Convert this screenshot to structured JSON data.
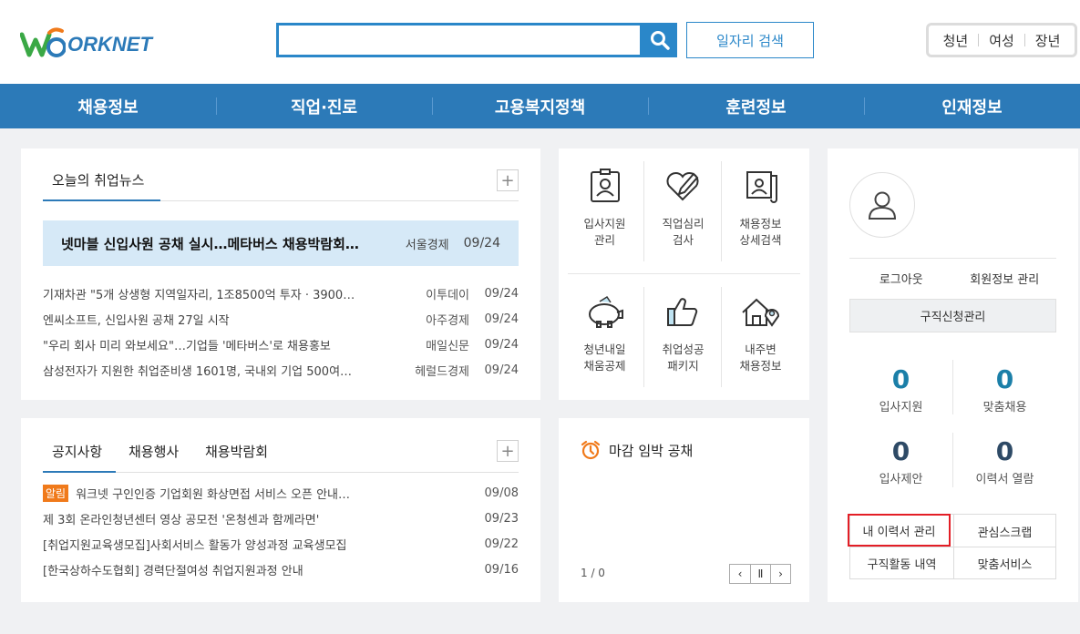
{
  "header": {
    "logo_text": "ORKNET",
    "search_placeholder": "",
    "search_value": "",
    "job_search_label": "일자리 검색",
    "user_types": [
      "청년",
      "여성",
      "장년"
    ]
  },
  "gnb": [
    "채용정보",
    "직업·진로",
    "고용복지정책",
    "훈련정보",
    "인재정보"
  ],
  "news": {
    "tab": "오늘의 취업뉴스",
    "plus": "+",
    "headline": {
      "title": "넷마블 신입사원 공채 실시…메타버스 채용박람회…",
      "source": "서울경제",
      "date": "09/24"
    },
    "items": [
      {
        "title": "기재차관 \"5개 상생형 지역일자리, 1조8500억 투자 · 3900…",
        "source": "이투데이",
        "date": "09/24"
      },
      {
        "title": "엔씨소프트, 신입사원 공채 27일 시작",
        "source": "아주경제",
        "date": "09/24"
      },
      {
        "title": "\"우리 회사 미리 와보세요\"…기업들 '메타버스'로 채용홍보",
        "source": "매일신문",
        "date": "09/24"
      },
      {
        "title": "삼성전자가 지원한 취업준비생 1601명, 국내외 기업 500여…",
        "source": "헤럴드경제",
        "date": "09/24"
      }
    ]
  },
  "notice": {
    "tabs": [
      "공지사항",
      "채용행사",
      "채용박람회"
    ],
    "plus": "+",
    "badge": "알림",
    "items": [
      {
        "title": "워크넷 구인인증 기업회원 화상면접 서비스 오픈 안내…",
        "date": "09/08"
      },
      {
        "title": "제 3회 온라인청년센터 영상 공모전 '온청센과 함께라면'",
        "date": "09/23"
      },
      {
        "title": "[취업지원교육생모집]사회서비스 활동가 양성과정 교육생모집",
        "date": "09/22"
      },
      {
        "title": "[한국상하수도협회] 경력단절여성 취업지원과정 안내",
        "date": "09/16"
      }
    ]
  },
  "menu": [
    {
      "line1": "입사지원",
      "line2": "관리",
      "icon": "id-card-icon"
    },
    {
      "line1": "직업심리",
      "line2": "검사",
      "icon": "heart-pen-icon"
    },
    {
      "line1": "채용정보",
      "line2": "상세검색",
      "icon": "scroll-icon"
    },
    {
      "line1": "청년내일",
      "line2": "채움공제",
      "icon": "piggy-bank-icon"
    },
    {
      "line1": "취업성공",
      "line2": "패키지",
      "icon": "thumbs-up-icon"
    },
    {
      "line1": "내주변",
      "line2": "채용정보",
      "icon": "house-pin-icon"
    }
  ],
  "deadline": {
    "title": "마감 임박 공채",
    "pager_text": "1 / 0",
    "prev": "‹",
    "pause": "Ⅱ",
    "next": "›"
  },
  "mypage": {
    "logout": "로그아웃",
    "member_info": "회원정보 관리",
    "manage": "구직신청관리",
    "stats": [
      {
        "value": "0",
        "label": "입사지원",
        "color": "#1b7fa8"
      },
      {
        "value": "0",
        "label": "맞춤채용",
        "color": "#1b7fa8"
      },
      {
        "value": "0",
        "label": "입사제안",
        "color": "#2e4a66"
      },
      {
        "value": "0",
        "label": "이력서 열람",
        "color": "#2e4a66"
      }
    ],
    "buttons": [
      "내 이력서 관리",
      "관심스크랩",
      "구직활동 내역",
      "맞춤서비스"
    ]
  }
}
